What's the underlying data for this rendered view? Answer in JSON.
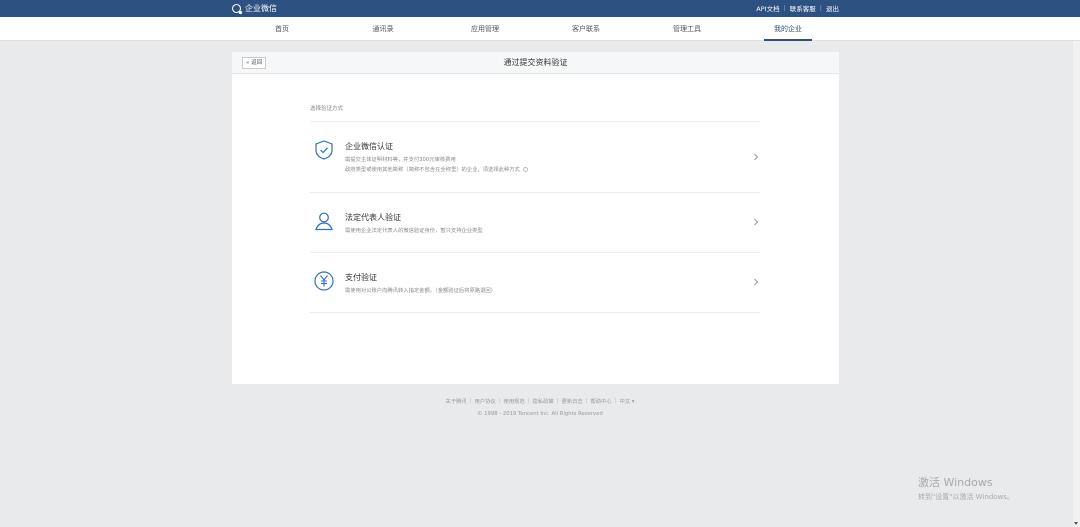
{
  "topbar": {
    "brand": "企业微信",
    "links": [
      "API文档",
      "联系客服",
      "退出"
    ]
  },
  "nav": {
    "tabs": [
      "首页",
      "通讯录",
      "应用管理",
      "客户联系",
      "管理工具",
      "我的企业"
    ],
    "active": "我的企业"
  },
  "page": {
    "back_label": "« 返回",
    "title": "通过提交资料验证",
    "section_label": "选择验证方式"
  },
  "options": [
    {
      "icon": "shield-check-icon",
      "title": "企业微信认证",
      "desc1": "需提交主体证明材料等，并支付300元审核费用",
      "desc2": "政府类型或使用其他简称（简称不包含在全称里）的企业，须选择此种方式"
    },
    {
      "icon": "person-icon",
      "title": "法定代表人验证",
      "desc1": "需使用企业法定代表人的微信验证身份，暂只支持企业类型"
    },
    {
      "icon": "yuan-icon",
      "title": "支付验证",
      "desc1": "需使用对公账户向腾讯转入指定金额。（金额验证后将原路退回）"
    }
  ],
  "footer": {
    "links": [
      "关于腾讯",
      "用户协议",
      "使用规范",
      "隐私政策",
      "更新日志",
      "帮助中心",
      "中文 ▾"
    ],
    "copyright": "© 1998 - 2019 Tencent Inc. All Rights Reserved"
  },
  "watermark": {
    "line1": "激活 Windows",
    "line2": "转到\"设置\"以激活 Windows。"
  },
  "colors": {
    "brand": "#2d5180",
    "icon": "#2d6fbf",
    "background": "#e9eaec"
  }
}
